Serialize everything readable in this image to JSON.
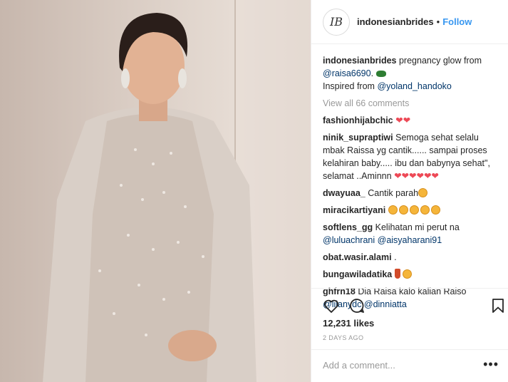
{
  "header": {
    "username": "indonesianbrides",
    "separator": "•",
    "follow_label": "Follow",
    "avatar_letter": "IB"
  },
  "caption": {
    "username": "indonesianbrides",
    "text": "pregnancy glow from",
    "mention1": "@raisa6690",
    "after_mention1": ".",
    "line2_prefix": "Inspired from",
    "mention2": "@yoland_handoko"
  },
  "view_all": "View all 66 comments",
  "comments": [
    {
      "user": "fashionhijabchic",
      "text": "❤❤"
    },
    {
      "user": "ninik_supraptiwi",
      "text": "Semoga sehat selalu mbak Raissa yg cantik...... sampai proses kelahiran baby..... ibu dan babynya sehat\", selamat ..Aminnn",
      "hearts": "❤❤❤❤❤❤"
    },
    {
      "user": "dwayuaa_",
      "text": "Cantik parah"
    },
    {
      "user": "miracikartiyani",
      "text": ""
    },
    {
      "user": "softlens_gg",
      "text": "Kelihatan mi perut na",
      "m1": "@luluachrani",
      "m2": "@aisyaharani91"
    },
    {
      "user": "obat.wasir.alami",
      "text": "."
    },
    {
      "user": "bungawiladatika",
      "text": ""
    },
    {
      "user": "ghfrn18",
      "text": "Dia Raisa kalo kalian Raiso",
      "m1": "@lilanydc",
      "m2": "@dinniatta"
    }
  ],
  "likes": "12,231 likes",
  "time_ago": "2 DAYS AGO",
  "add_comment_placeholder": "Add a comment...",
  "more_label": "•••",
  "icons": [
    "heart-icon",
    "comment-icon",
    "bookmark-icon",
    "more-options-icon"
  ],
  "colors": {
    "link": "#3897f0",
    "mention": "#003569",
    "muted": "#999999",
    "heart": "#ed4956"
  }
}
